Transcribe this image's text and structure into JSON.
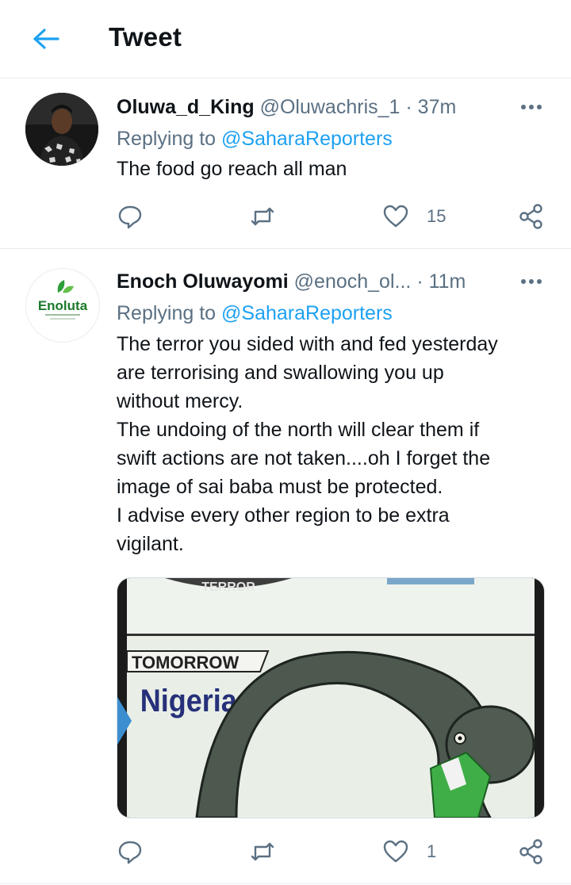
{
  "header": {
    "title": "Tweet"
  },
  "tweets": [
    {
      "name": "Oluwa_d_King",
      "handle": "@Oluwachris_1",
      "time": "· 37m",
      "replying_prefix": "Replying to",
      "replying_handle": "@SaharaReporters",
      "text": "The food go reach all man",
      "like_count": "15",
      "reply_count": "",
      "retweet_count": ""
    },
    {
      "name": "Enoch Oluwayomi",
      "handle": "@enoch_ol...",
      "time": "· 11m",
      "replying_prefix": "Replying to",
      "replying_handle": "@SaharaReporters",
      "text": "The terror you sided with and fed yesterday\nare terrorising and swallowing you up\nwithout mercy.\nThe undoing of the north will clear them if\nswift actions are not taken....oh I forget the\nimage of sai baba must be protected.\nI advise every other region to be extra\nvigilant.",
      "like_count": "1",
      "reply_count": "",
      "retweet_count": "",
      "avatar_logo": "Enoluta",
      "media": {
        "top_caption": "TERROR",
        "caption": "TOMORROW",
        "subtitle": "Nigeria"
      }
    }
  ],
  "colors": {
    "accent": "#1da1f2",
    "muted": "#5b7083",
    "text": "#0f1419",
    "divider": "#e6ecf0"
  },
  "icons": [
    "back-arrow-icon",
    "more-icon",
    "reply-icon",
    "retweet-icon",
    "like-icon",
    "share-icon"
  ]
}
